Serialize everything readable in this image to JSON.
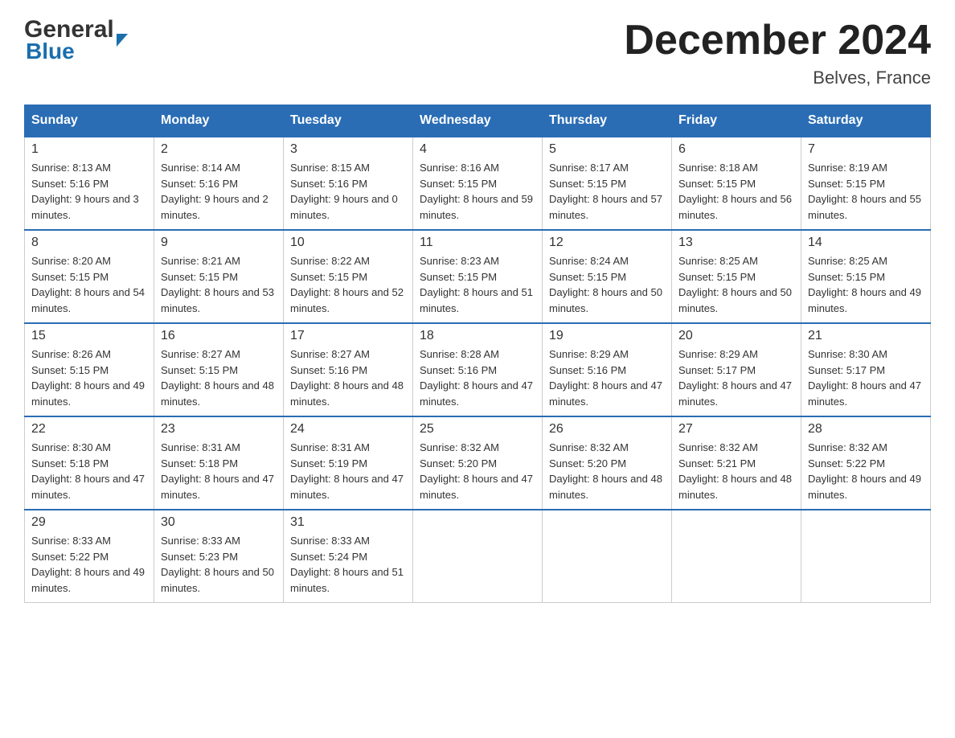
{
  "header": {
    "logo_general": "General",
    "logo_blue": "Blue",
    "month_title": "December 2024",
    "location": "Belves, France"
  },
  "calendar": {
    "days_of_week": [
      "Sunday",
      "Monday",
      "Tuesday",
      "Wednesday",
      "Thursday",
      "Friday",
      "Saturday"
    ],
    "weeks": [
      [
        {
          "day": "1",
          "sunrise": "8:13 AM",
          "sunset": "5:16 PM",
          "daylight": "9 hours and 3 minutes."
        },
        {
          "day": "2",
          "sunrise": "8:14 AM",
          "sunset": "5:16 PM",
          "daylight": "9 hours and 2 minutes."
        },
        {
          "day": "3",
          "sunrise": "8:15 AM",
          "sunset": "5:16 PM",
          "daylight": "9 hours and 0 minutes."
        },
        {
          "day": "4",
          "sunrise": "8:16 AM",
          "sunset": "5:15 PM",
          "daylight": "8 hours and 59 minutes."
        },
        {
          "day": "5",
          "sunrise": "8:17 AM",
          "sunset": "5:15 PM",
          "daylight": "8 hours and 57 minutes."
        },
        {
          "day": "6",
          "sunrise": "8:18 AM",
          "sunset": "5:15 PM",
          "daylight": "8 hours and 56 minutes."
        },
        {
          "day": "7",
          "sunrise": "8:19 AM",
          "sunset": "5:15 PM",
          "daylight": "8 hours and 55 minutes."
        }
      ],
      [
        {
          "day": "8",
          "sunrise": "8:20 AM",
          "sunset": "5:15 PM",
          "daylight": "8 hours and 54 minutes."
        },
        {
          "day": "9",
          "sunrise": "8:21 AM",
          "sunset": "5:15 PM",
          "daylight": "8 hours and 53 minutes."
        },
        {
          "day": "10",
          "sunrise": "8:22 AM",
          "sunset": "5:15 PM",
          "daylight": "8 hours and 52 minutes."
        },
        {
          "day": "11",
          "sunrise": "8:23 AM",
          "sunset": "5:15 PM",
          "daylight": "8 hours and 51 minutes."
        },
        {
          "day": "12",
          "sunrise": "8:24 AM",
          "sunset": "5:15 PM",
          "daylight": "8 hours and 50 minutes."
        },
        {
          "day": "13",
          "sunrise": "8:25 AM",
          "sunset": "5:15 PM",
          "daylight": "8 hours and 50 minutes."
        },
        {
          "day": "14",
          "sunrise": "8:25 AM",
          "sunset": "5:15 PM",
          "daylight": "8 hours and 49 minutes."
        }
      ],
      [
        {
          "day": "15",
          "sunrise": "8:26 AM",
          "sunset": "5:15 PM",
          "daylight": "8 hours and 49 minutes."
        },
        {
          "day": "16",
          "sunrise": "8:27 AM",
          "sunset": "5:15 PM",
          "daylight": "8 hours and 48 minutes."
        },
        {
          "day": "17",
          "sunrise": "8:27 AM",
          "sunset": "5:16 PM",
          "daylight": "8 hours and 48 minutes."
        },
        {
          "day": "18",
          "sunrise": "8:28 AM",
          "sunset": "5:16 PM",
          "daylight": "8 hours and 47 minutes."
        },
        {
          "day": "19",
          "sunrise": "8:29 AM",
          "sunset": "5:16 PM",
          "daylight": "8 hours and 47 minutes."
        },
        {
          "day": "20",
          "sunrise": "8:29 AM",
          "sunset": "5:17 PM",
          "daylight": "8 hours and 47 minutes."
        },
        {
          "day": "21",
          "sunrise": "8:30 AM",
          "sunset": "5:17 PM",
          "daylight": "8 hours and 47 minutes."
        }
      ],
      [
        {
          "day": "22",
          "sunrise": "8:30 AM",
          "sunset": "5:18 PM",
          "daylight": "8 hours and 47 minutes."
        },
        {
          "day": "23",
          "sunrise": "8:31 AM",
          "sunset": "5:18 PM",
          "daylight": "8 hours and 47 minutes."
        },
        {
          "day": "24",
          "sunrise": "8:31 AM",
          "sunset": "5:19 PM",
          "daylight": "8 hours and 47 minutes."
        },
        {
          "day": "25",
          "sunrise": "8:32 AM",
          "sunset": "5:20 PM",
          "daylight": "8 hours and 47 minutes."
        },
        {
          "day": "26",
          "sunrise": "8:32 AM",
          "sunset": "5:20 PM",
          "daylight": "8 hours and 48 minutes."
        },
        {
          "day": "27",
          "sunrise": "8:32 AM",
          "sunset": "5:21 PM",
          "daylight": "8 hours and 48 minutes."
        },
        {
          "day": "28",
          "sunrise": "8:32 AM",
          "sunset": "5:22 PM",
          "daylight": "8 hours and 49 minutes."
        }
      ],
      [
        {
          "day": "29",
          "sunrise": "8:33 AM",
          "sunset": "5:22 PM",
          "daylight": "8 hours and 49 minutes."
        },
        {
          "day": "30",
          "sunrise": "8:33 AM",
          "sunset": "5:23 PM",
          "daylight": "8 hours and 50 minutes."
        },
        {
          "day": "31",
          "sunrise": "8:33 AM",
          "sunset": "5:24 PM",
          "daylight": "8 hours and 51 minutes."
        },
        null,
        null,
        null,
        null
      ]
    ]
  },
  "labels": {
    "sunrise_label": "Sunrise:",
    "sunset_label": "Sunset:",
    "daylight_label": "Daylight:"
  }
}
